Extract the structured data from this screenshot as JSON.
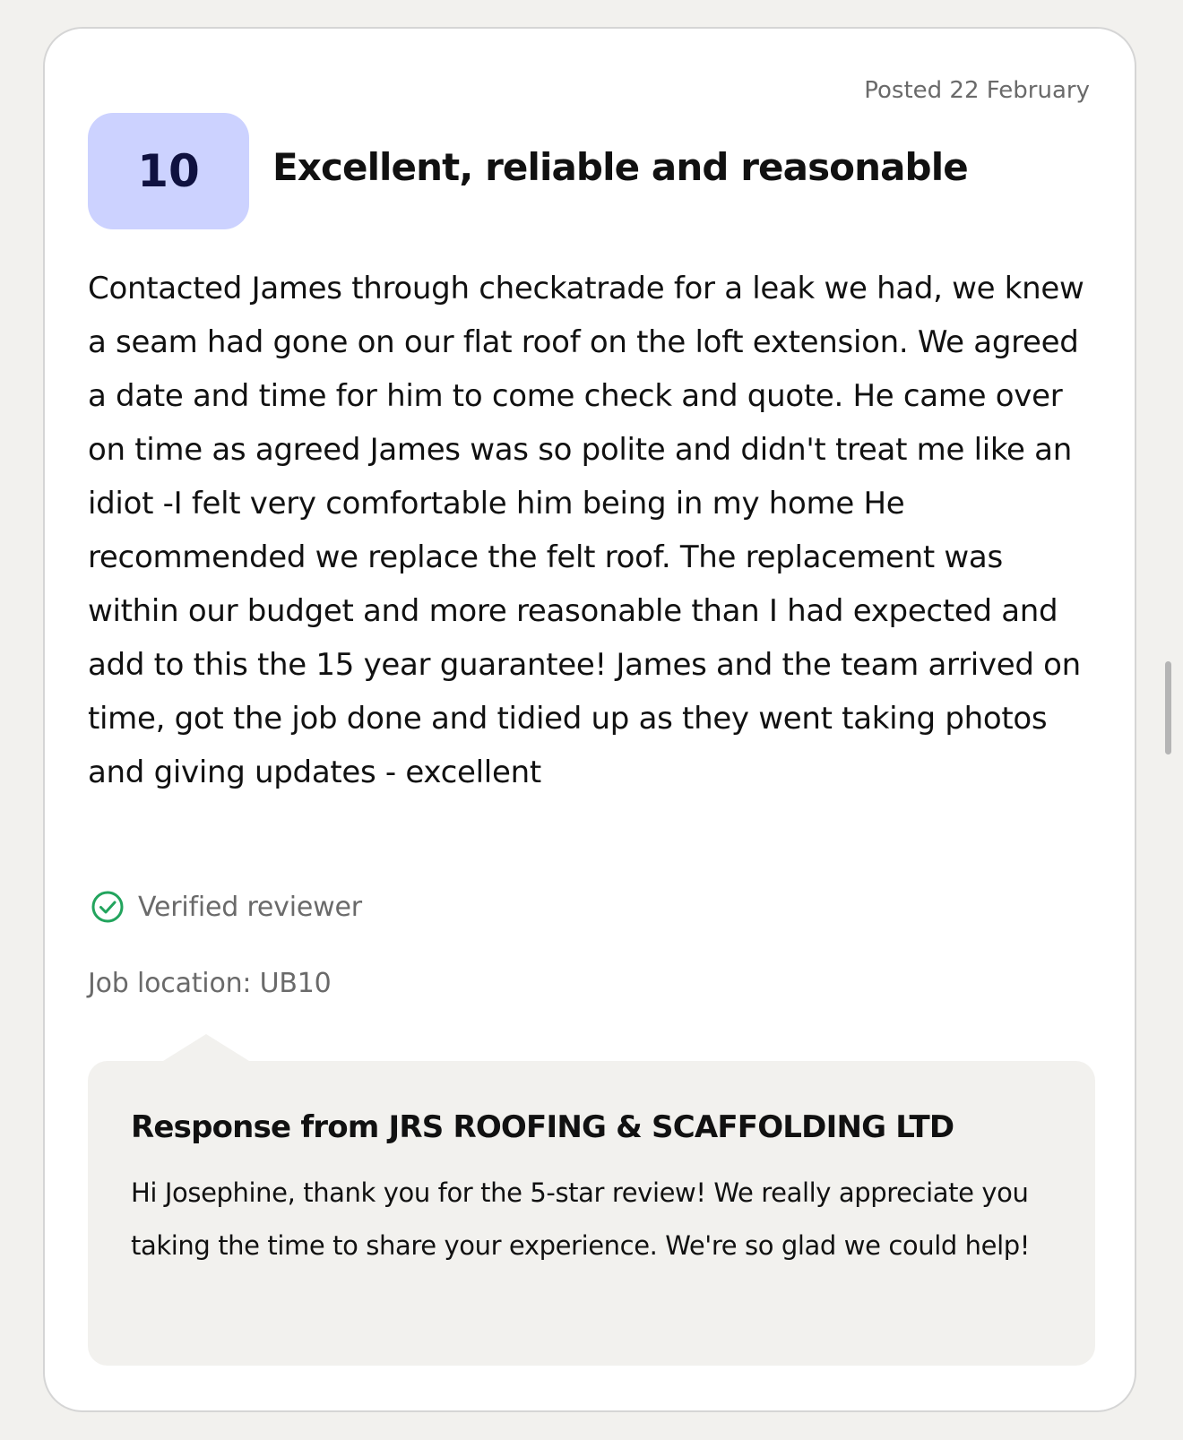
{
  "review": {
    "posted": "Posted 22 February",
    "score": "10",
    "title": "Excellent, reliable and reasonable",
    "body": "Contacted James through checkatrade for a leak we had, we knew a seam had gone on our flat roof on the loft extension. We agreed a date and time for him to come check and quote. He came over on time as agreed James was so polite and didn't treat me like an idiot -I felt very comfortable him being in my home He recommended we replace the felt roof. The replacement was within our budget and more reasonable than I had expected and add to this the 15 year guarantee! James and the team arrived on time, got the job done and tidied up as they went taking photos and giving updates - excellent",
    "verified_label": "Verified reviewer",
    "verified_icon": "check-circle-icon",
    "job_location": "Job location: UB10"
  },
  "response": {
    "title": "Response from JRS ROOFING & SCAFFOLDING LTD",
    "body": "Hi Josephine, thank you for the 5-star review! We really appreciate you taking the time to share your experience. We're so glad we could help!"
  },
  "colors": {
    "page_background": "#f2f1ee",
    "card_background": "#ffffff",
    "score_badge": "#ccd2ff",
    "score_text": "#0f1140",
    "verified_green": "#22a45d",
    "muted_text": "#6a6a6a",
    "response_background": "#f2f1ee"
  }
}
